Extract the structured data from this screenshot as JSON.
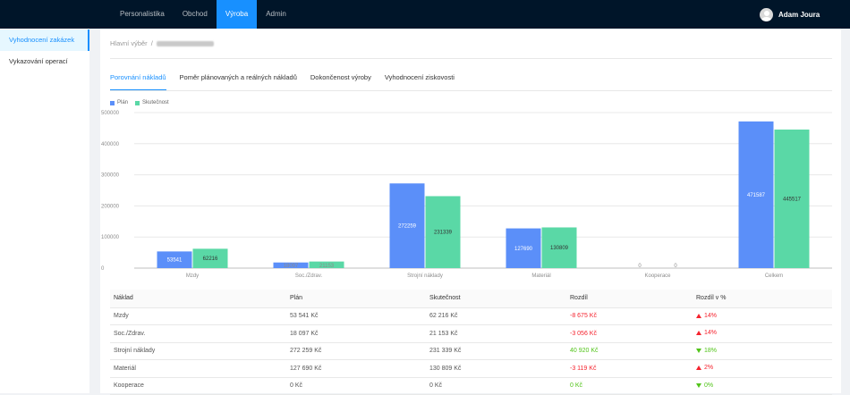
{
  "topnav": {
    "items": [
      {
        "label": "Personalistika",
        "active": false
      },
      {
        "label": "Obchod",
        "active": false
      },
      {
        "label": "Výroba",
        "active": true
      },
      {
        "label": "Admin",
        "active": false
      }
    ]
  },
  "user": {
    "name": "Adam Joura"
  },
  "sidebar": {
    "items": [
      {
        "label": "Vyhodnocení zakázek",
        "active": true
      },
      {
        "label": "Vykazování operací",
        "active": false
      }
    ]
  },
  "breadcrumb": {
    "root": "Hlavní výběr",
    "separator": "/"
  },
  "tabs": [
    {
      "label": "Porovnání nákladů",
      "active": true
    },
    {
      "label": "Poměr plánovaných a reálných nákladů",
      "active": false
    },
    {
      "label": "Dokončenost výroby",
      "active": false
    },
    {
      "label": "Vyhodnocení ziskovosti",
      "active": false
    }
  ],
  "chart_data": {
    "type": "bar",
    "categories": [
      "Mzdy",
      "Soc./Zdrav.",
      "Strojní náklady",
      "Materiál",
      "Kooperace",
      "Celkem"
    ],
    "series": [
      {
        "name": "Plán",
        "color": "#5b8ff9",
        "values": [
          53541,
          18097,
          272259,
          127690,
          0,
          471587
        ]
      },
      {
        "name": "Skutečnost",
        "color": "#5ad8a6",
        "values": [
          62216,
          21153,
          231339,
          130809,
          0,
          445517
        ]
      }
    ],
    "ylim": [
      0,
      500000
    ],
    "yticks": [
      0,
      100000,
      200000,
      300000,
      400000,
      500000
    ],
    "legend": "top-left",
    "grid": true
  },
  "table": {
    "columns": [
      "Náklad",
      "Plán",
      "Skutečnost",
      "Rozdíl",
      "Rozdíl v %"
    ],
    "rows": [
      {
        "name": "Mzdy",
        "plan": "53 541 Kč",
        "actual": "62 216 Kč",
        "diff": "-8 675 Kč",
        "diff_sign": "neg",
        "pct": "14%",
        "trend": "up"
      },
      {
        "name": "Soc./Zdrav.",
        "plan": "18 097 Kč",
        "actual": "21 153 Kč",
        "diff": "-3 056 Kč",
        "diff_sign": "neg",
        "pct": "14%",
        "trend": "up"
      },
      {
        "name": "Strojní náklady",
        "plan": "272 259 Kč",
        "actual": "231 339 Kč",
        "diff": "40 920 Kč",
        "diff_sign": "pos",
        "pct": "18%",
        "trend": "down"
      },
      {
        "name": "Materiál",
        "plan": "127 690 Kč",
        "actual": "130 809 Kč",
        "diff": "-3 119 Kč",
        "diff_sign": "neg",
        "pct": "2%",
        "trend": "up"
      },
      {
        "name": "Kooperace",
        "plan": "0 Kč",
        "actual": "0 Kč",
        "diff": "0 Kč",
        "diff_sign": "pos",
        "pct": "0%",
        "trend": "down"
      }
    ]
  }
}
